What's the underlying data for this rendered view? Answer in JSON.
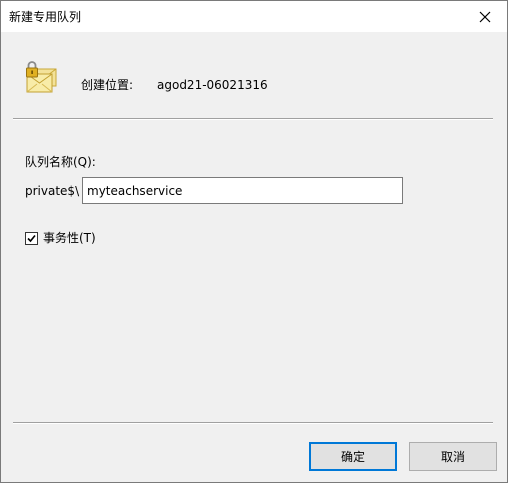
{
  "window": {
    "title": "新建专用队列"
  },
  "location": {
    "label": "创建位置:",
    "value": "agod21-06021316"
  },
  "queue": {
    "name_label": "队列名称(Q):",
    "prefix": "private$\\",
    "name_value": "myteachservice"
  },
  "transactional": {
    "label": "事务性(T)",
    "checked": true
  },
  "buttons": {
    "ok_label": "确定",
    "cancel_label": "取消"
  },
  "icons": {
    "close": "close-icon",
    "queue": "message-queue-lock-icon",
    "check": "checkmark-icon"
  },
  "colors": {
    "accent": "#0078d7",
    "dialog_bg": "#f0f0f0",
    "titlebar_bg": "#ffffff"
  }
}
